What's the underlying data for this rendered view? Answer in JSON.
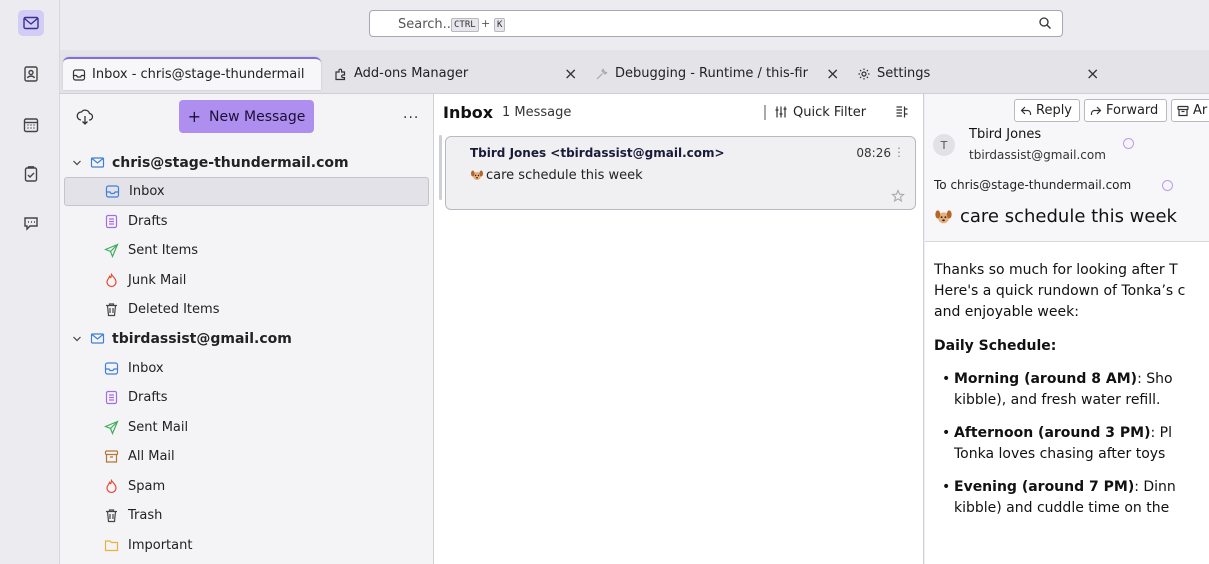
{
  "search": {
    "placeholder": "Search...",
    "shortcut_ctrl": "CTRL",
    "shortcut_plus": "+",
    "shortcut_key": "K"
  },
  "spaces": [
    {
      "name": "mail",
      "icon": "mail-icon",
      "active": true
    },
    {
      "name": "address-book",
      "icon": "address-book-icon",
      "active": false
    },
    {
      "name": "calendar",
      "icon": "calendar-icon",
      "active": false
    },
    {
      "name": "tasks",
      "icon": "tasks-icon",
      "active": false
    },
    {
      "name": "chat",
      "icon": "chat-icon",
      "active": false
    }
  ],
  "tabs": [
    {
      "label": "Inbox - chris@stage-thundermail",
      "icon": "inbox-icon",
      "selected": true
    },
    {
      "label": "Add-ons Manager",
      "icon": "puzzle-icon",
      "selected": false,
      "close": "×"
    },
    {
      "label": "Debugging - Runtime / this-fir",
      "icon": "wrench-icon",
      "selected": false,
      "close": "×"
    },
    {
      "label": "Settings",
      "icon": "gear-icon",
      "selected": false,
      "close": "×"
    }
  ],
  "folder_pane": {
    "new_message": "New Message",
    "new_message_plus": "+",
    "menu": "...",
    "accounts": [
      {
        "name": "chris@stage-thundermail.com",
        "folders": [
          {
            "label": "Inbox",
            "icon": "inbox-icon",
            "selected": true
          },
          {
            "label": "Drafts",
            "icon": "drafts-icon"
          },
          {
            "label": "Sent Items",
            "icon": "sent-icon"
          },
          {
            "label": "Junk Mail",
            "icon": "junk-icon"
          },
          {
            "label": "Deleted Items",
            "icon": "trash-icon"
          }
        ]
      },
      {
        "name": "tbirdassist@gmail.com",
        "folders": [
          {
            "label": "Inbox",
            "icon": "inbox-icon"
          },
          {
            "label": "Drafts",
            "icon": "drafts-icon"
          },
          {
            "label": "Sent Mail",
            "icon": "sent-icon"
          },
          {
            "label": "All Mail",
            "icon": "archive-icon"
          },
          {
            "label": "Spam",
            "icon": "junk-icon"
          },
          {
            "label": "Trash",
            "icon": "trash-icon"
          },
          {
            "label": "Important",
            "icon": "folder-icon"
          }
        ]
      }
    ]
  },
  "message_list": {
    "title": "Inbox",
    "count": "1 Message",
    "quick_filter": "Quick Filter",
    "messages": [
      {
        "from": "Tbird Jones <tbirdassist@gmail.com>",
        "time": "08:26",
        "more": "⋮",
        "subject": "care schedule this week"
      }
    ]
  },
  "reader": {
    "buttons": {
      "reply": "Reply",
      "forward": "Forward",
      "archive": "Ar"
    },
    "avatar": "T",
    "sender_name": "Tbird Jones",
    "sender_email": "tbirdassist@gmail.com",
    "to_line": "To chris@stage-thundermail.com",
    "subject": "care schedule this week",
    "body": {
      "p1": "Thanks so much for looking after T",
      "p2": "Here's a quick rundown of Tonka’s c",
      "p3": "and enjoyable week:",
      "heading": "Daily Schedule:",
      "items": [
        {
          "bold": "Morning (around 8 AM)",
          "rest": ": Sho",
          "line2": "kibble), and fresh water refill."
        },
        {
          "bold": "Afternoon (around 3 PM)",
          "rest": ": Pl",
          "line2": "Tonka loves chasing after toys"
        },
        {
          "bold": "Evening (around 7 PM)",
          "rest": ": Dinn",
          "line2": "kibble) and cuddle time on the"
        }
      ]
    }
  },
  "colors": {
    "accent": "#ae8ff0",
    "tab_accent": "#7d6ee3",
    "drafts": "#a56de2",
    "sent": "#3fae5a",
    "junk": "#e8492e",
    "inbox": "#3f7fd9",
    "important": "#e6b23a"
  }
}
